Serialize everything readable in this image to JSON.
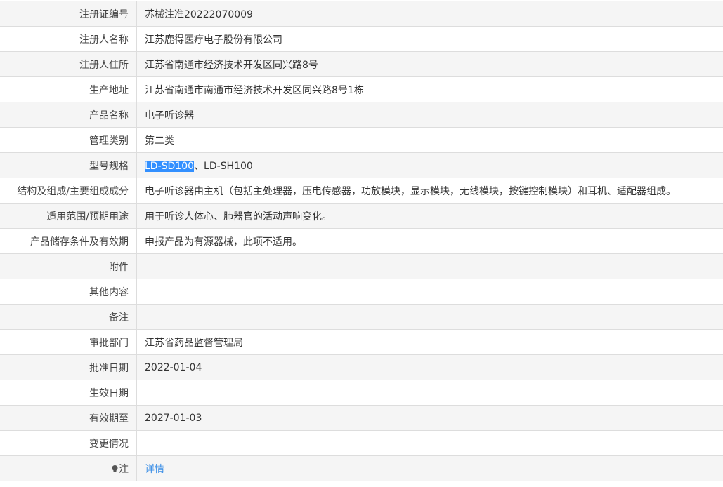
{
  "rows": [
    {
      "label": "注册证编号",
      "value": "苏械注准20222070009"
    },
    {
      "label": "注册人名称",
      "value": "江苏鹿得医疗电子股份有限公司"
    },
    {
      "label": "注册人住所",
      "value": "江苏省南通市经济技术开发区同兴路8号"
    },
    {
      "label": "生产地址",
      "value": "江苏省南通市南通市经济技术开发区同兴路8号1栋"
    },
    {
      "label": "产品名称",
      "value": "电子听诊器"
    },
    {
      "label": "管理类别",
      "value": "第二类"
    },
    {
      "label": "型号规格",
      "value_selected": "LD-SD100",
      "value_rest": "、LD-SH100"
    },
    {
      "label": "结构及组成/主要组成成分",
      "value": "电子听诊器由主机（包括主处理器，压电传感器，功放模块，显示模块，无线模块，按键控制模块）和耳机、适配器组成。"
    },
    {
      "label": "适用范围/预期用途",
      "value": "用于听诊人体心、肺器官的活动声响变化。"
    },
    {
      "label": "产品储存条件及有效期",
      "value": "申报产品为有源器械，此项不适用。"
    },
    {
      "label": "附件",
      "value": ""
    },
    {
      "label": "其他内容",
      "value": ""
    },
    {
      "label": "备注",
      "value": ""
    },
    {
      "label": "审批部门",
      "value": "江苏省药品监督管理局"
    },
    {
      "label": "批准日期",
      "value": "2022-01-04"
    },
    {
      "label": "生效日期",
      "value": ""
    },
    {
      "label": "有效期至",
      "value": "2027-01-03"
    },
    {
      "label": "变更情况",
      "value": ""
    },
    {
      "label": "注",
      "icon": "lightbulb-icon",
      "value": "详情"
    }
  ]
}
